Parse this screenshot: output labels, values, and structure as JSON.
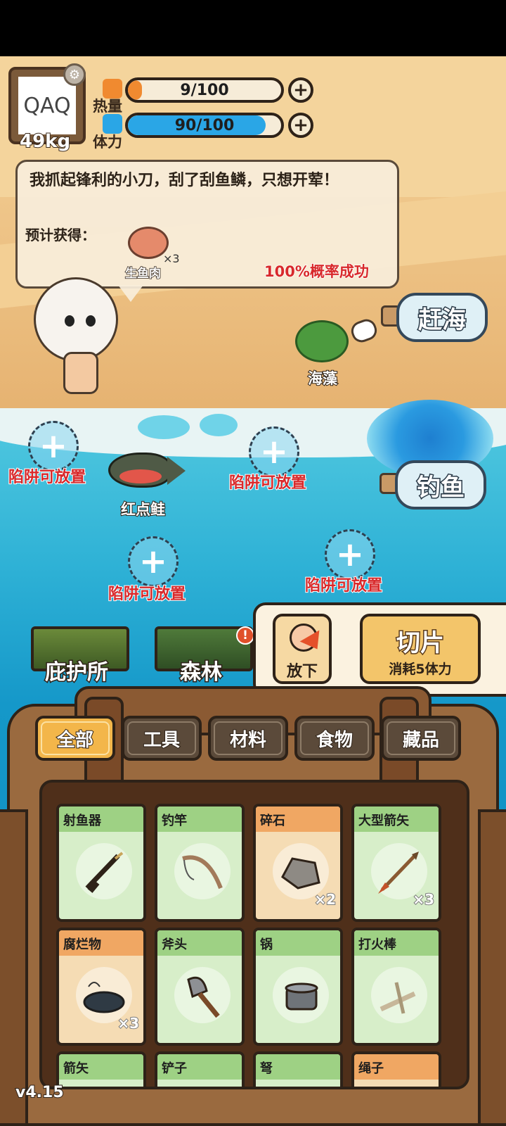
{
  "player": {
    "avatar_text": "QAQ",
    "weight": "49kg",
    "settings_icon": "gear-icon"
  },
  "stats": {
    "heat": {
      "label": "热量",
      "value": "9/100",
      "fraction": 0.09,
      "icon": "flame-icon",
      "color": "#f08a30"
    },
    "stamina": {
      "label": "体力",
      "value": "90/100",
      "fraction": 0.9,
      "icon": "lightning-icon",
      "color": "#2aa6e6"
    }
  },
  "dialog": {
    "message": "我抓起锋利的小刀，刮了刮鱼鳞，只想开荤！",
    "expected_label": "预计获得：",
    "reward_name": "生鱼肉",
    "reward_count": "×3",
    "success_chance": "100%概率成功"
  },
  "beach": {
    "seaweed_label": "海藻",
    "beachcomb_button": "赶海",
    "fishing_button": "钓鱼"
  },
  "traps": {
    "placeable_label": "陷阱可放置",
    "fish_label": "红点鲑"
  },
  "locations": [
    {
      "label": "庇护所"
    },
    {
      "label": "森林",
      "alert": "!"
    }
  ],
  "actions": {
    "drop_label": "放下",
    "slice_label": "切片",
    "slice_cost": "消耗5体力"
  },
  "tabs": [
    "全部",
    "工具",
    "材料",
    "食物",
    "藏品"
  ],
  "active_tab": "全部",
  "inventory": [
    {
      "name": "射鱼器",
      "count": "",
      "kind": "tool"
    },
    {
      "name": "钓竿",
      "count": "",
      "kind": "tool"
    },
    {
      "name": "碎石",
      "count": "×2",
      "kind": "material"
    },
    {
      "name": "大型箭矢",
      "count": "×3",
      "kind": "tool"
    },
    {
      "name": "腐烂物",
      "count": "×3",
      "kind": "material"
    },
    {
      "name": "斧头",
      "count": "",
      "kind": "tool"
    },
    {
      "name": "锅",
      "count": "",
      "kind": "tool"
    },
    {
      "name": "打火棒",
      "count": "",
      "kind": "tool"
    },
    {
      "name": "箭矢",
      "count": "",
      "kind": "tool"
    },
    {
      "name": "铲子",
      "count": "",
      "kind": "tool"
    },
    {
      "name": "弩",
      "count": "",
      "kind": "tool"
    },
    {
      "name": "绳子",
      "count": "",
      "kind": "material"
    }
  ],
  "version": "v4.15"
}
